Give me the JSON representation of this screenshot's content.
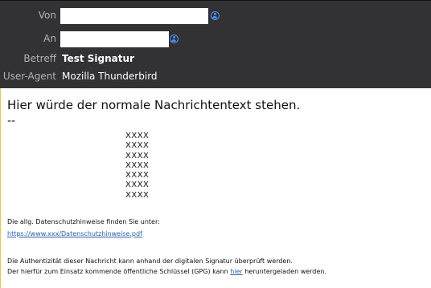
{
  "header": {
    "from_label": "Von",
    "to_label": "An",
    "subject_label": "Betreff",
    "subject_value": "Test Signatur",
    "useragent_label": "User-Agent",
    "useragent_value": "Mozilla Thunderbird",
    "from_icon": "contact-icon",
    "to_icon": "contact-icon"
  },
  "message": {
    "lead_text": "Hier würde der normale Nachrichtentext stehen.",
    "separator": "--",
    "signature_lines": [
      "XXXX",
      "XXXX",
      "XXXX",
      "XXXX",
      "XXXX",
      "XXXX",
      "XXXX"
    ],
    "privacy_text": "Die allg. Datenschutzhinweise finden Sie unter:",
    "privacy_link": "https://www.xxx/Datenschutzhinweise.pdf",
    "auth_line1": "Die Authentizität dieser Nachricht kann anhand der digitalen Signatur überprüft werden.",
    "auth_line2_before": "Der hierfür zum Einsatz kommende öffentliche Schlüssel (GPG) kann ",
    "auth_line2_link": "hier",
    "auth_line2_after": " heruntergeladen werden."
  },
  "colors": {
    "header_bg": "#323234",
    "accent": "#4a90ff",
    "link": "#2a5db0"
  }
}
